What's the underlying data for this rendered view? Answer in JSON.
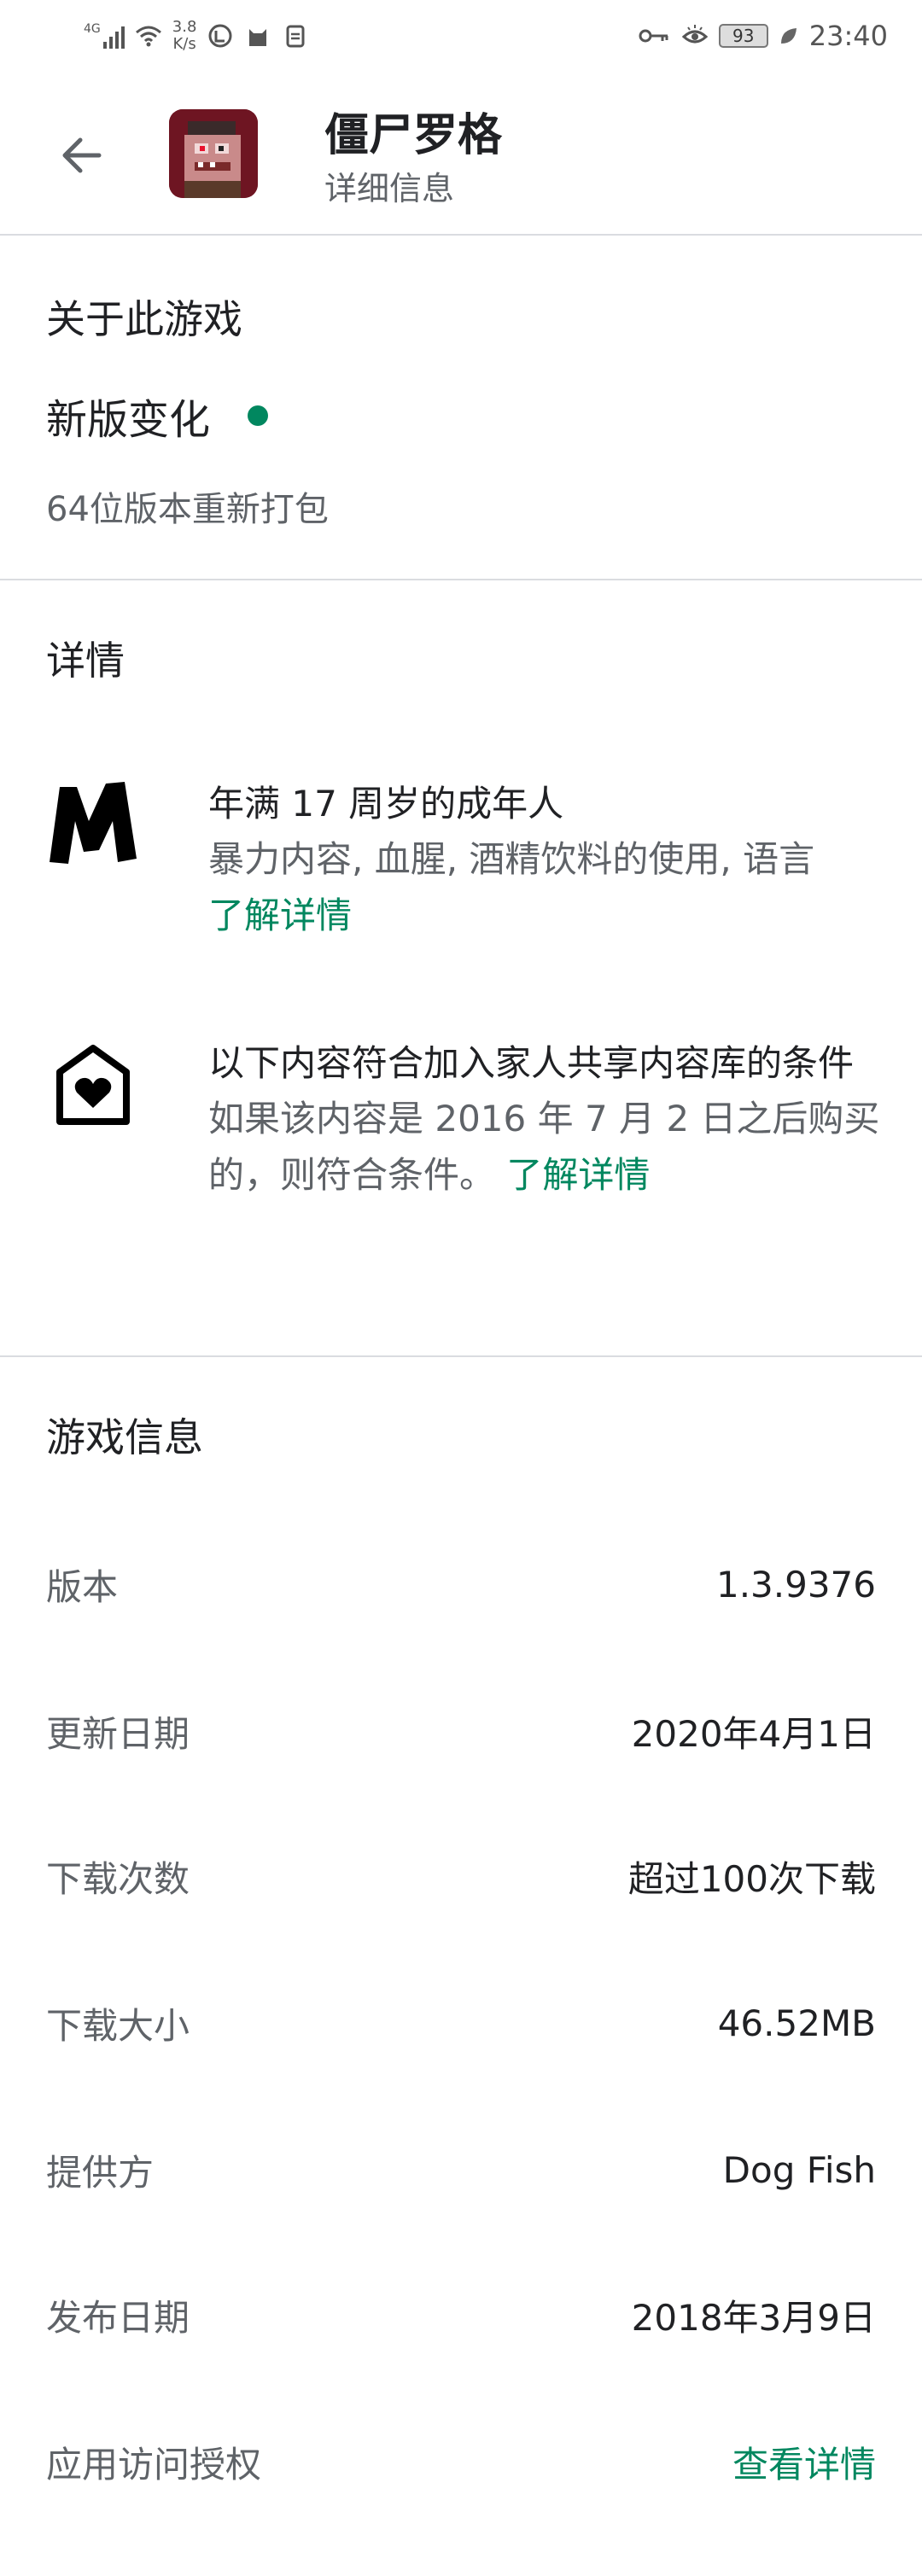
{
  "status_bar": {
    "signal_label": "4G",
    "net_speed_value": "3.8",
    "net_speed_unit": "K/s",
    "battery": "93",
    "time": "23:40"
  },
  "header": {
    "title": "僵尸罗格",
    "subtitle": "详细信息"
  },
  "about": {
    "title": "关于此游戏",
    "whats_new_label": "新版变化",
    "whats_new_text": "64位版本重新打包"
  },
  "details": {
    "title": "详情",
    "rating": {
      "main": "年满 17 周岁的成年人",
      "sub": "暴力内容, 血腥, 酒精饮料的使用, 语言",
      "link": "了解详情"
    },
    "family": {
      "main": "以下内容符合加入家人共享内容库的条件",
      "sub": "如果该内容是 2016 年 7 月 2 日之后购买的，则符合条件。",
      "link": "了解详情"
    }
  },
  "game_info": {
    "title": "游戏信息",
    "rows": [
      {
        "label": "版本",
        "value": "1.3.9376"
      },
      {
        "label": "更新日期",
        "value": "2020年4月1日"
      },
      {
        "label": "下载次数",
        "value": "超过100次下载"
      },
      {
        "label": "下载大小",
        "value": "46.52MB"
      },
      {
        "label": "提供方",
        "value": "Dog Fish"
      },
      {
        "label": "发布日期",
        "value": "2018年3月9日"
      },
      {
        "label": "应用访问授权",
        "value": "查看详情"
      }
    ]
  },
  "colors": {
    "accent": "#01875f",
    "text_primary": "#202124",
    "text_secondary": "#5f6368",
    "divider": "#dadce0"
  }
}
